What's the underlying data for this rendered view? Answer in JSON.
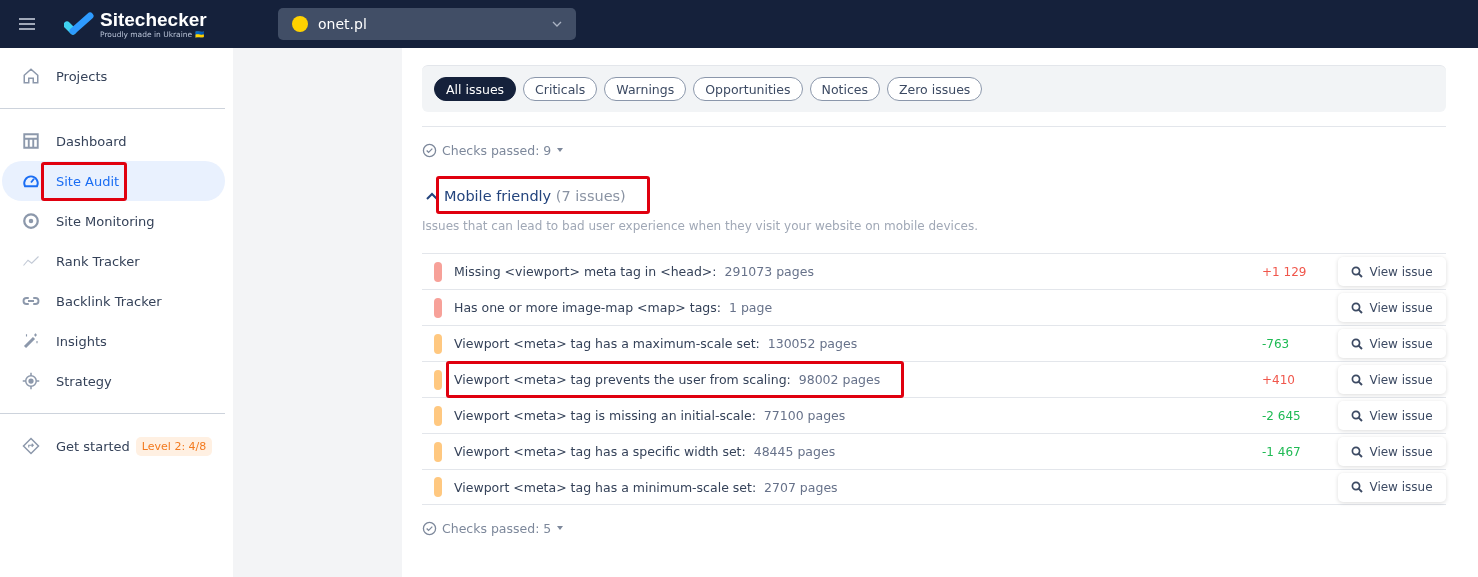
{
  "header": {
    "brand": "Sitechecker",
    "tagline": "Proudly made in Ukraine 🇺🇦",
    "project": {
      "name": "onet.pl",
      "color": "#ffd200"
    }
  },
  "sidebar": {
    "top": [
      {
        "label": "Projects",
        "selected": false,
        "highlighted": false
      }
    ],
    "items": [
      {
        "label": "Dashboard",
        "selected": false,
        "highlighted": false
      },
      {
        "label": "Site Audit",
        "selected": true,
        "highlighted": true
      },
      {
        "label": "Site Monitoring",
        "selected": false,
        "highlighted": false
      },
      {
        "label": "Rank Tracker",
        "selected": false,
        "highlighted": false
      },
      {
        "label": "Backlink Tracker",
        "selected": false,
        "highlighted": false
      },
      {
        "label": "Insights",
        "selected": false,
        "highlighted": false
      },
      {
        "label": "Strategy",
        "selected": false,
        "highlighted": false
      }
    ],
    "bottom": [
      {
        "label": "Get started",
        "badge": "Level 2: 4/8",
        "selected": false,
        "highlighted": false
      }
    ]
  },
  "filters": [
    {
      "label": "All issues",
      "selected": true
    },
    {
      "label": "Criticals",
      "selected": false
    },
    {
      "label": "Warnings",
      "selected": false
    },
    {
      "label": "Opportunities",
      "selected": false
    },
    {
      "label": "Notices",
      "selected": false
    },
    {
      "label": "Zero issues",
      "selected": false
    }
  ],
  "prev_checks_passed": "Checks passed: 9",
  "section": {
    "title": "Mobile friendly",
    "count": "(7 issues)",
    "expanded": true,
    "highlighted": true,
    "description": "Issues that can lead to bad user experience when they visit your website on mobile devices.",
    "issues": [
      {
        "color": "#f7a199",
        "title": "Missing <viewport> meta tag in <head>:",
        "pages": "291073 pages",
        "delta": {
          "text": "+1 129",
          "color": "#f0564b"
        },
        "highlighted": false,
        "action": "View issue"
      },
      {
        "color": "#f7a199",
        "title": "Has one or more image-map <map> tags:",
        "pages": "1 page",
        "highlighted": false,
        "action": "View issue"
      },
      {
        "color": "#ffc880",
        "title": "Viewport <meta> tag has a maximum-scale set:",
        "pages": "130052 pages",
        "delta": {
          "text": "-763",
          "color": "#1fba54"
        },
        "highlighted": false,
        "action": "View issue"
      },
      {
        "color": "#ffc880",
        "title": "Viewport <meta> tag prevents the user from scaling:",
        "pages": "98002 pages",
        "delta": {
          "text": "+410",
          "color": "#f0564b"
        },
        "highlighted": true,
        "action": "View issue"
      },
      {
        "color": "#ffc880",
        "title": "Viewport <meta> tag is missing an initial-scale:",
        "pages": "77100 pages",
        "delta": {
          "text": "-2 645",
          "color": "#1fba54"
        },
        "highlighted": false,
        "action": "View issue"
      },
      {
        "color": "#ffc880",
        "title": "Viewport <meta> tag has a specific width set:",
        "pages": "48445 pages",
        "delta": {
          "text": "-1 467",
          "color": "#1fba54"
        },
        "highlighted": false,
        "action": "View issue"
      },
      {
        "color": "#ffc880",
        "title": "Viewport <meta> tag has a minimum-scale set:",
        "pages": "2707 pages",
        "highlighted": false,
        "action": "View issue"
      }
    ],
    "checks_passed": "Checks passed: 5"
  }
}
